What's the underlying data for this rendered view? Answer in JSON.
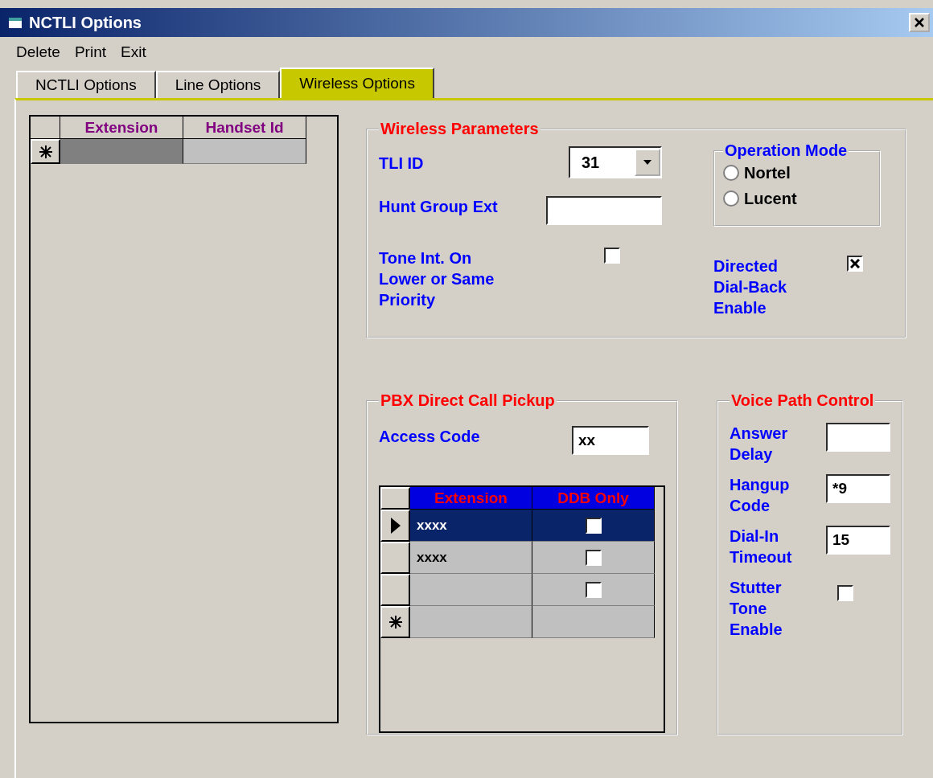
{
  "window": {
    "title": "NCTLI Options"
  },
  "menu": [
    {
      "label": "Delete"
    },
    {
      "label": "Print"
    },
    {
      "label": "Exit"
    }
  ],
  "tabs": [
    {
      "label": "NCTLI Options",
      "selected": false
    },
    {
      "label": "Line Options",
      "selected": false
    },
    {
      "label": "Wireless Options",
      "selected": true
    }
  ],
  "handset_grid": {
    "columns": [
      "Extension",
      "Handset Id"
    ],
    "rows": [
      {
        "kind": "new"
      }
    ]
  },
  "wireless_parameters": {
    "title": "Wireless Parameters",
    "tli_id": {
      "label": "TLI ID",
      "value": "31"
    },
    "hunt_group_ext": {
      "label": "Hunt Group Ext"
    },
    "tone_int": {
      "label": "Tone Int. On Lower or Same Priority",
      "checked": false
    },
    "operation_mode": {
      "title": "Operation Mode",
      "options": [
        {
          "label": "Nortel",
          "selected": false
        },
        {
          "label": "Lucent",
          "selected": false
        }
      ]
    },
    "directed_dial_back": {
      "label": "Directed Dial-Back Enable",
      "checked": true
    }
  },
  "pbx_direct_call_pickup": {
    "title": "PBX Direct Call Pickup",
    "access_code": {
      "label": "Access Code",
      "value": "xx"
    },
    "grid": {
      "columns": [
        "Extension",
        "DDB Only"
      ],
      "rows": [
        {
          "kind": "current",
          "selected": true,
          "extension": "xxxx",
          "ddb_only": false
        },
        {
          "kind": "none",
          "selected": false,
          "extension": "xxxx",
          "ddb_only": false
        },
        {
          "kind": "none",
          "selected": false,
          "ddb_only": false
        },
        {
          "kind": "new",
          "selected": false
        }
      ]
    }
  },
  "voice_path_control": {
    "title": "Voice Path Control",
    "fields": [
      {
        "kind": "input",
        "label": "Answer Delay"
      },
      {
        "kind": "input",
        "label": "Hangup Code",
        "value": "*9"
      },
      {
        "kind": "input",
        "label": "Dial-In Timeout",
        "value": "15"
      },
      {
        "kind": "checkbox",
        "label": "Stutter Tone Enable",
        "checked": false
      }
    ]
  }
}
